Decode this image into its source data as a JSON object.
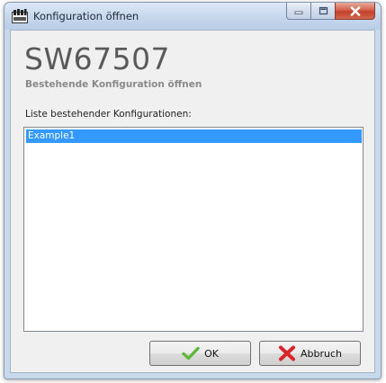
{
  "window": {
    "title": "Konfiguration öffnen"
  },
  "header": {
    "app_name": "SW67507",
    "subtitle": "Bestehende Konfiguration öffnen"
  },
  "config_list": {
    "label": "Liste bestehender Konfigurationen:",
    "items": [
      {
        "label": "Example1",
        "selected": true
      }
    ]
  },
  "buttons": {
    "ok_label": "OK",
    "cancel_label": "Abbruch"
  },
  "icons": {
    "app": "app-icon",
    "ok": "checkmark-icon",
    "cancel": "red-x-icon"
  },
  "colors": {
    "selection": "#3399ff",
    "close_button": "#c2402a",
    "ok_check": "#5fb83a",
    "cancel_x": "#d8262b"
  }
}
